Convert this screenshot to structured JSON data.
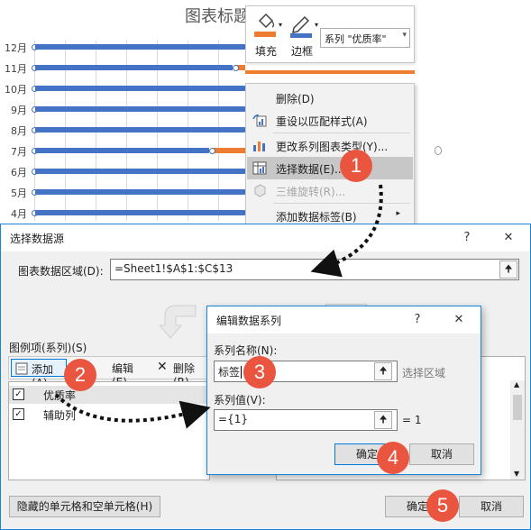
{
  "chart": {
    "title": "图表标题",
    "months": [
      "12月",
      "11月",
      "10月",
      "9月",
      "8月",
      "7月",
      "6月",
      "5月",
      "4月"
    ]
  },
  "chart_data": {
    "type": "bar",
    "title": "图表标题",
    "categories": [
      "12月",
      "11月",
      "10月",
      "9月",
      "8月",
      "7月",
      "6月",
      "5月",
      "4月"
    ],
    "series": [
      {
        "name": "优质率",
        "color": "#4472c4"
      },
      {
        "name": "辅助列",
        "color": "#ed7d31"
      }
    ]
  },
  "minibar": {
    "fill_label": "填充",
    "border_label": "边框",
    "series_selector": "系列 \"优质率\""
  },
  "context_menu": {
    "items": [
      {
        "label": "删除(D)",
        "icon": "none"
      },
      {
        "label": "重设以匹配样式(A)",
        "icon": "reset-style-icon"
      },
      {
        "label": "更改系列图表类型(Y)...",
        "icon": "chart-type-icon"
      },
      {
        "label": "选择数据(E)...",
        "icon": "select-data-icon"
      },
      {
        "label": "三维旋转(R)...",
        "icon": "3d-rotate-icon"
      },
      {
        "label": "添加数据标签(B)",
        "icon": "none"
      }
    ]
  },
  "select_data_dialog": {
    "title": "选择数据源",
    "help": "?",
    "close": "✕",
    "range_label": "图表数据区域(D):",
    "range_value": "=Sheet1!$A$1:$C$13",
    "legend_label": "图例项(系列)(S)",
    "add_button": "添加(A)",
    "edit_button": "编辑(E)",
    "delete_button": "删除(R)",
    "series": [
      {
        "name": "优质率",
        "checked": true
      },
      {
        "name": "辅助列",
        "checked": true
      }
    ],
    "hidden_cells_button": "隐藏的单元格和空单元格(H)",
    "ok": "确定",
    "cancel": "取消"
  },
  "edit_series_dialog": {
    "title": "编辑数据系列",
    "help": "?",
    "close": "✕",
    "name_label": "系列名称(N):",
    "name_value": "标签",
    "select_range_hint": "选择区域",
    "values_label": "系列值(V):",
    "values_value": "={1}",
    "values_preview": "= 1",
    "ok": "确定",
    "cancel": "取消"
  },
  "steps": [
    "1",
    "2",
    "3",
    "4",
    "5"
  ]
}
